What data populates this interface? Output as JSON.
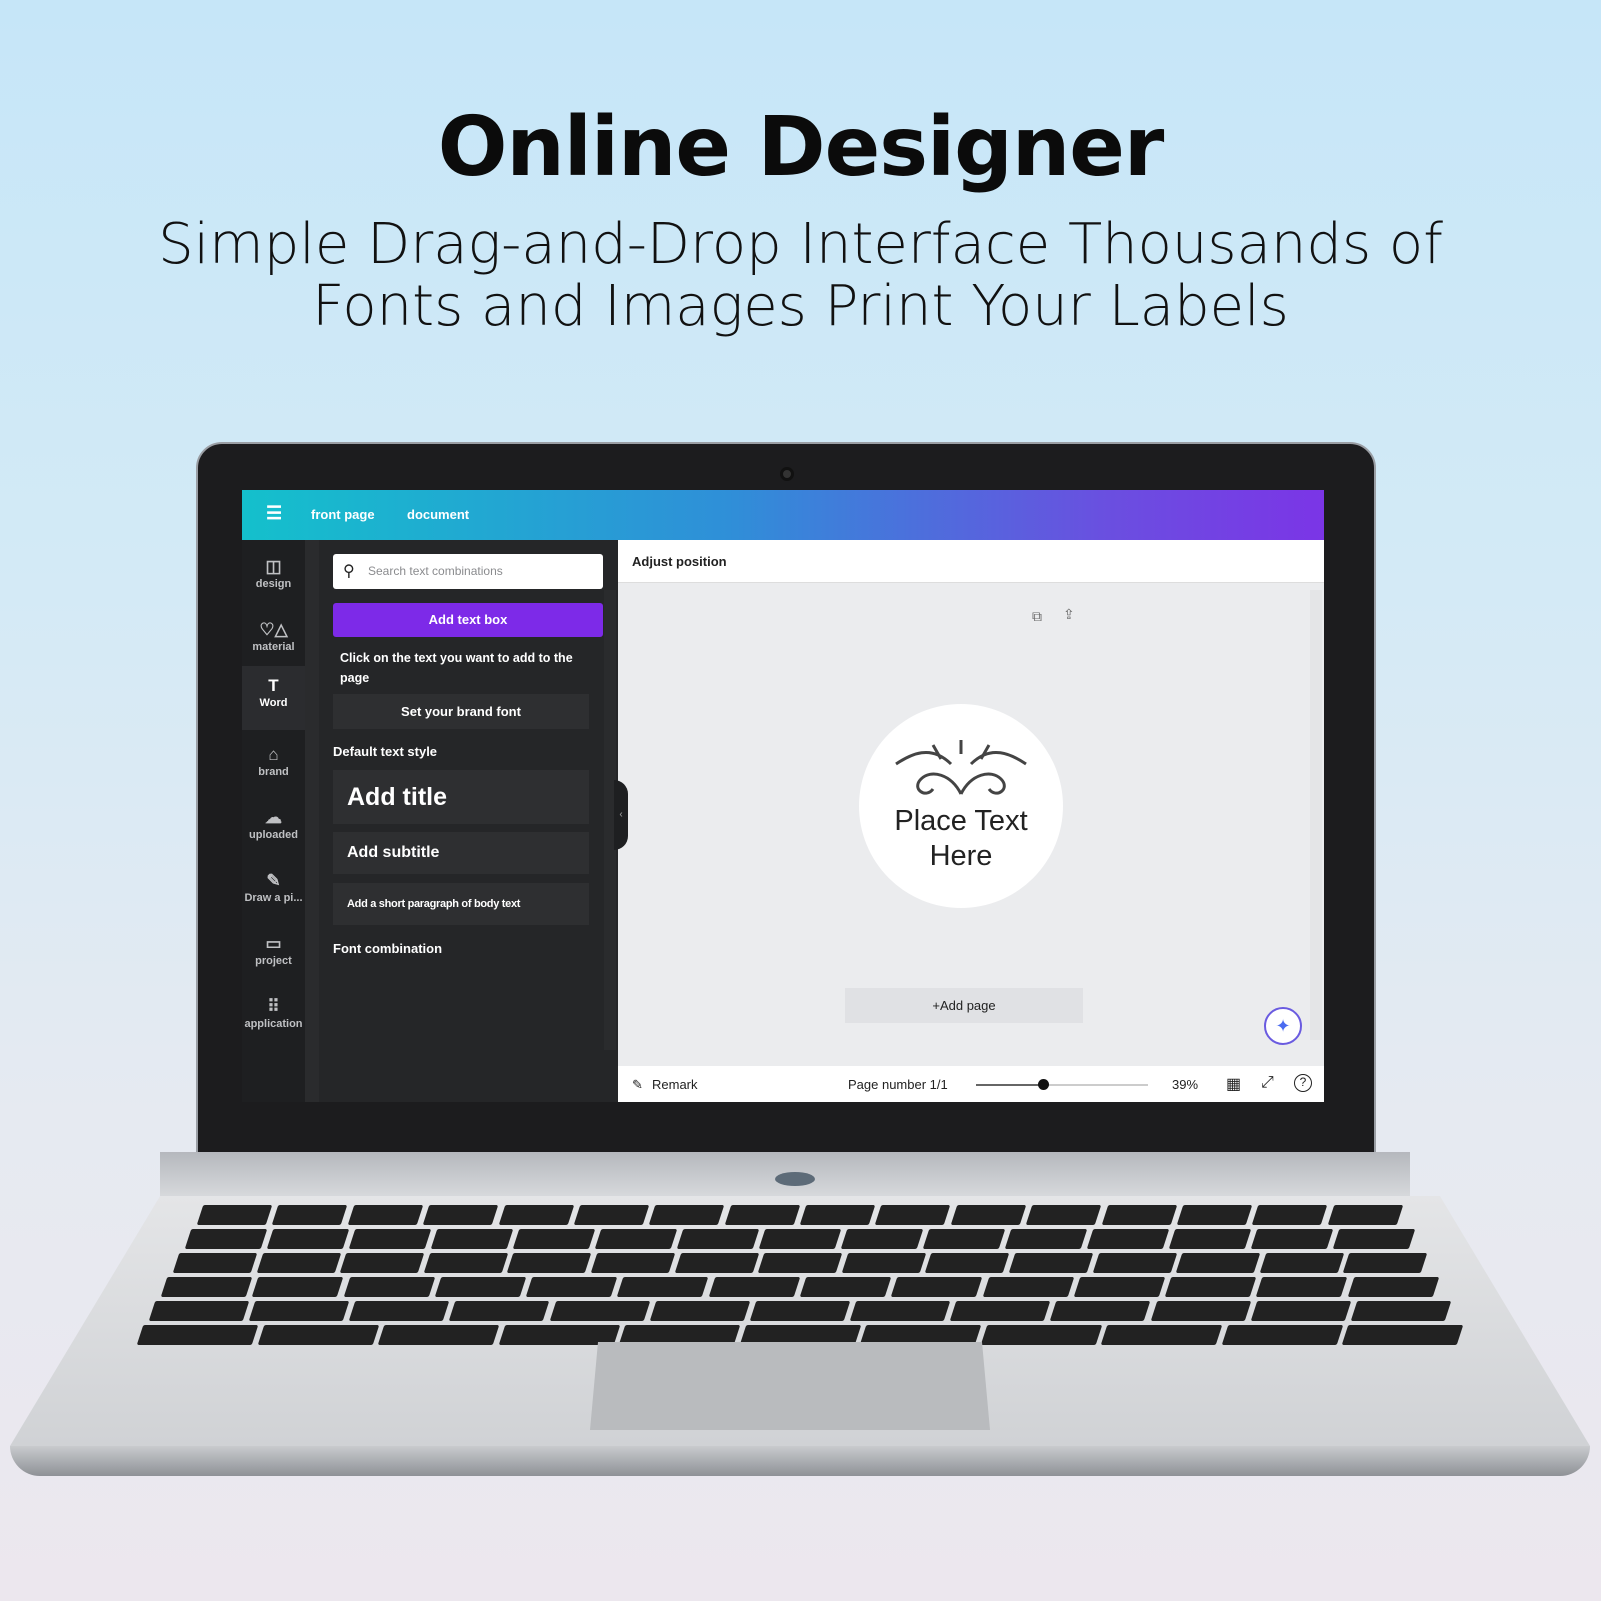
{
  "headline": {
    "title": "Online Designer",
    "subtitle_line1": "Simple Drag-and-Drop Interface Thousands of",
    "subtitle_line2": "Fonts and Images Print Your Labels"
  },
  "app": {
    "header": {
      "menu_icon": "hamburger-icon",
      "tabs": [
        "front page",
        "document"
      ]
    },
    "sidebar": {
      "items": [
        {
          "label": "design",
          "icon": "layout-icon"
        },
        {
          "label": "material",
          "icon": "shapes-icon"
        },
        {
          "label": "Word",
          "icon": "text-icon",
          "active": true
        },
        {
          "label": "brand",
          "icon": "brand-icon"
        },
        {
          "label": "uploaded",
          "icon": "cloud-upload-icon"
        },
        {
          "label": "Draw a pi...",
          "icon": "draw-icon"
        },
        {
          "label": "project",
          "icon": "folder-icon"
        },
        {
          "label": "application",
          "icon": "apps-grid-icon"
        }
      ]
    },
    "panel": {
      "search_placeholder": "Search text combinations",
      "add_text_box": "Add text box",
      "hint": "Click on the text you want to add to the page",
      "brand_font": "Set your brand font",
      "default_text_style": "Default text style",
      "add_title": "Add title",
      "add_subtitle": "Add subtitle",
      "add_body": "Add a short paragraph of body text",
      "font_combination": "Font combination"
    },
    "canvas": {
      "toolbar_label": "Adjust position",
      "label_text": "Place Text Here",
      "add_page": "+Add page"
    },
    "footer": {
      "remark": "Remark",
      "page_number": "Page number 1/1",
      "zoom": "39%",
      "zoom_value": 39
    },
    "accent_color": "#7d2ae8"
  }
}
